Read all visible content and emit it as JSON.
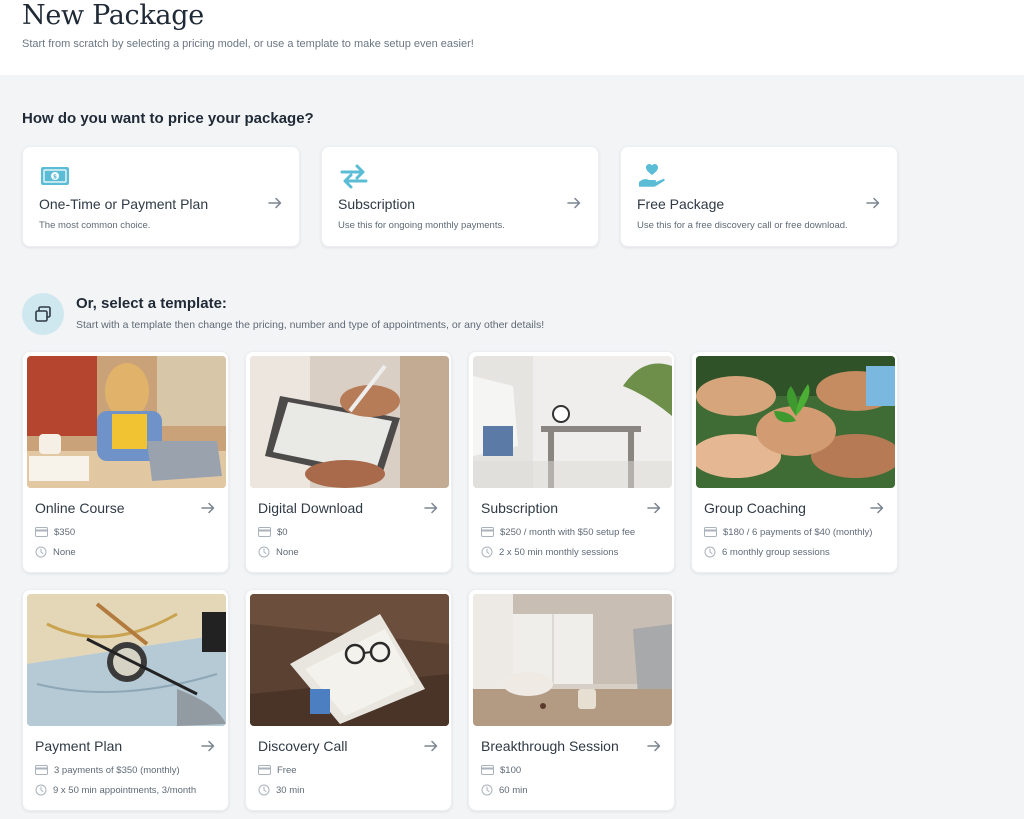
{
  "header": {
    "title": "New Package",
    "subtitle": "Start from scratch by selecting a pricing model, or use a template to make setup even easier!"
  },
  "pricing": {
    "heading": "How do you want to price your package?",
    "options": [
      {
        "title": "One-Time or Payment Plan",
        "desc": "The most common choice.",
        "icon": "money-icon"
      },
      {
        "title": "Subscription",
        "desc": "Use this for ongoing monthly payments.",
        "icon": "repeat-icon"
      },
      {
        "title": "Free Package",
        "desc": "Use this for a free discovery call or free download.",
        "icon": "heart-hand-icon"
      }
    ]
  },
  "templates": {
    "heading": "Or, select a template:",
    "subtitle": "Start with a template then change the pricing, number and type of appointments, or any other details!",
    "items": [
      {
        "title": "Online Course",
        "price": "$350",
        "sessions": "None"
      },
      {
        "title": "Digital Download",
        "price": "$0",
        "sessions": "None"
      },
      {
        "title": "Subscription",
        "price": "$250 / month with $50 setup fee",
        "sessions": "2 x 50 min monthly sessions"
      },
      {
        "title": "Group Coaching",
        "price": "$180 / 6 payments of $40 (monthly)",
        "sessions": "6 monthly group sessions"
      },
      {
        "title": "Payment Plan",
        "price": "3 payments of $350 (monthly)",
        "sessions": "9 x 50 min appointments, 3/month"
      },
      {
        "title": "Discovery Call",
        "price": "Free",
        "sessions": "30 min"
      },
      {
        "title": "Breakthrough Session",
        "price": "$100",
        "sessions": "60 min"
      }
    ]
  },
  "colors": {
    "accent": "#5bbcd6",
    "background": "#f3f4f6",
    "card": "#ffffff"
  }
}
